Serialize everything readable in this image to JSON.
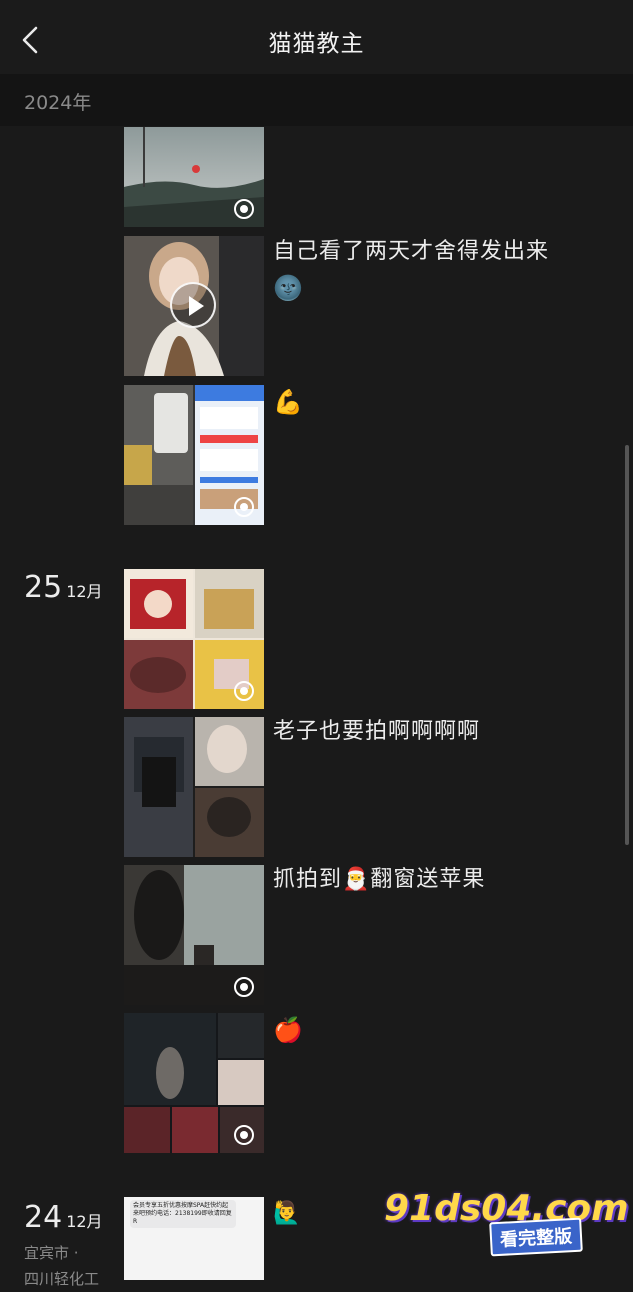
{
  "header": {
    "title": "猫猫教主",
    "back_icon": "chevron-left-icon"
  },
  "year_bar": {
    "label": "2024年"
  },
  "posts": [
    {
      "caption": "",
      "media": "photo"
    },
    {
      "caption": "自己看了两天才舍得发出来",
      "emoji": "🌚",
      "media": "video"
    },
    {
      "caption": "",
      "emoji": "💪",
      "media": "photo-grid"
    },
    {
      "caption": "",
      "media": "photo-grid"
    },
    {
      "caption": "老子也要拍啊啊啊啊",
      "media": "photo-grid"
    },
    {
      "caption_before": "抓拍到",
      "emoji": "🎅",
      "caption_after": "翻窗送苹果",
      "media": "photo"
    },
    {
      "caption": "",
      "emoji": "🍎",
      "media": "photo-grid"
    },
    {
      "caption": "",
      "emoji": "🙋‍♂️",
      "media": "screenshot",
      "thumb_text": "会员专享五折优惠按摩SPA赶快约起来吧预约电话：2138199即收请回复R"
    }
  ],
  "dates": [
    {
      "day": "25",
      "month": "12月"
    },
    {
      "day": "24",
      "month": "12月",
      "location_line1": "宜宾市 ·",
      "location_line2": "四川轻化工"
    }
  ],
  "watermark": {
    "site": "91ds04.com",
    "tagline": "看完整版"
  },
  "colors": {
    "background": "#1a1a1a",
    "header": "#1b1b1b",
    "year_bar": "#141414",
    "muted_text": "#8a8a8a"
  }
}
